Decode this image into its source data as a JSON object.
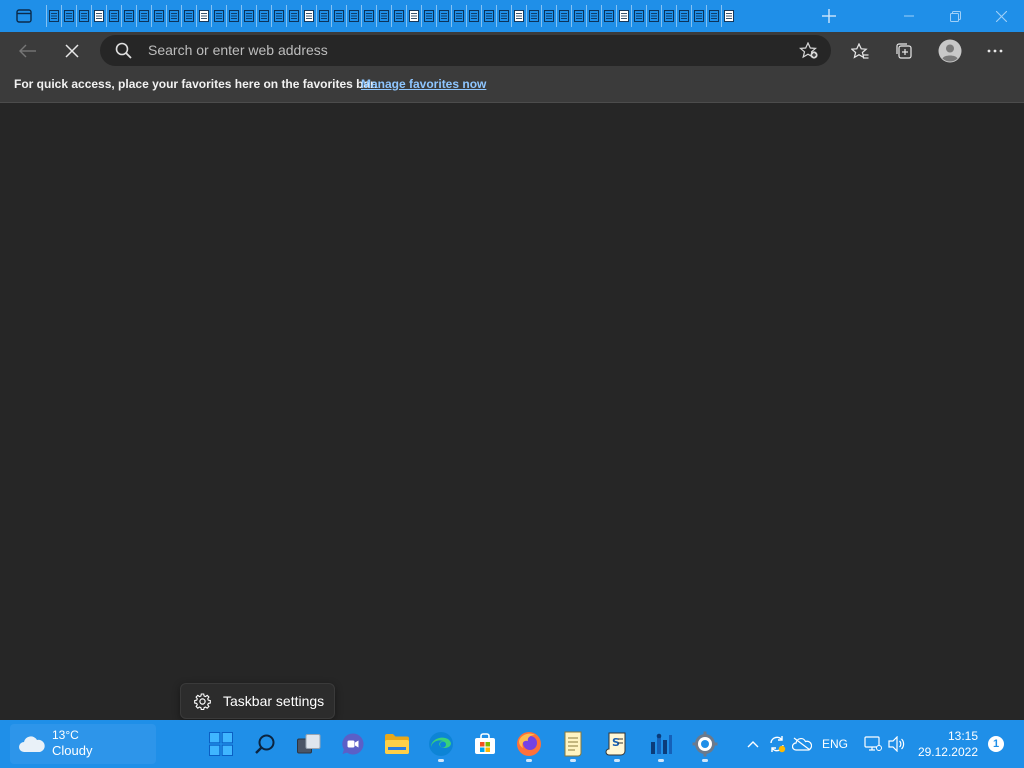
{
  "browser": {
    "tab_strip": {
      "tab_count_visible": 46,
      "new_tab_icon": "plus-icon",
      "tab_actions_icon": "tab-actions-icon"
    },
    "window_controls": {
      "minimize_icon": "minimize-icon",
      "restore_icon": "restore-icon",
      "close_icon": "close-icon"
    },
    "toolbar": {
      "back_icon": "back-arrow-icon",
      "stop_icon": "stop-loading-icon",
      "search_icon": "search-icon",
      "address_placeholder": "Search or enter web address",
      "add_favorite_icon": "add-favorite-icon",
      "favorites_icon": "favorites-icon",
      "collections_icon": "collections-icon",
      "profile_icon": "profile-avatar-icon",
      "more_icon": "more-menu-icon"
    },
    "favorites_bar": {
      "message": "For quick access, place your favorites here on the favorites bar.",
      "link": "Manage favorites now"
    }
  },
  "context_menu": {
    "items": [
      {
        "label": "Taskbar settings",
        "icon": "gear-icon"
      }
    ]
  },
  "taskbar": {
    "weather": {
      "temperature": "13°C",
      "condition": "Cloudy",
      "icon": "cloud-icon"
    },
    "apps": [
      {
        "name": "start",
        "icon": "windows-start-icon"
      },
      {
        "name": "search",
        "icon": "search-icon"
      },
      {
        "name": "task-view",
        "icon": "task-view-icon"
      },
      {
        "name": "chat",
        "icon": "teams-chat-icon"
      },
      {
        "name": "file-explorer",
        "icon": "folder-icon"
      },
      {
        "name": "edge",
        "icon": "edge-browser-icon",
        "running": true
      },
      {
        "name": "store",
        "icon": "store-icon"
      },
      {
        "name": "firefox",
        "icon": "firefox-icon",
        "running": true
      },
      {
        "name": "notepad",
        "icon": "notepad-icon",
        "running": true
      },
      {
        "name": "script-editor",
        "icon": "script-editor-icon",
        "running": true
      },
      {
        "name": "app-unknown",
        "icon": "network-app-icon",
        "running": true
      },
      {
        "name": "settings",
        "icon": "settings-gear-icon",
        "running": true
      }
    ],
    "tray": {
      "overflow_icon": "chevron-up-icon",
      "sync_icon": "sync-icon",
      "onedrive_icon": "onedrive-offline-icon",
      "language": "ENG",
      "network_icon": "network-icon",
      "volume_icon": "volume-icon"
    },
    "clock": {
      "time": "13:15",
      "date": "29.12.2022"
    },
    "notifications": {
      "count": "1"
    }
  },
  "colors": {
    "taskbar_accent": "#1f8fe8",
    "browser_chrome": "#3b3b3b",
    "page_background": "#262626",
    "link": "#8ec6ff"
  }
}
